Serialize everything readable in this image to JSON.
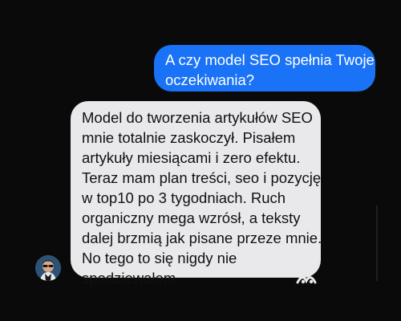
{
  "colors": {
    "background": "#0a0a0b",
    "outgoing_bubble": "#1a73f7",
    "incoming_bubble": "#e9e9eb",
    "outgoing_text": "#ffffff",
    "incoming_text": "#111111"
  },
  "conversation": {
    "outgoing_message": {
      "lines": [
        "A czy model SEO spełnia Twoje",
        "oczekiwania?"
      ]
    },
    "incoming_message": {
      "lines": [
        "Model do tworzenia artykułów SEO",
        "mnie totalnie zaskoczył. Pisałem",
        "artykuły miesiącami i zero efektu.",
        "Teraz mam plan treści, seo i pozycję",
        "w top10 po 3 tygodniach. Ruch",
        "organiczny mega wzrósł, a teksty",
        "dalej brzmią jak pisane przeze mnie.",
        "No tego to się nigdy nie",
        "spodziewałem."
      ]
    },
    "sender_avatar_icon": "user-avatar-icon",
    "reaction_icon": "reaction-icon"
  }
}
